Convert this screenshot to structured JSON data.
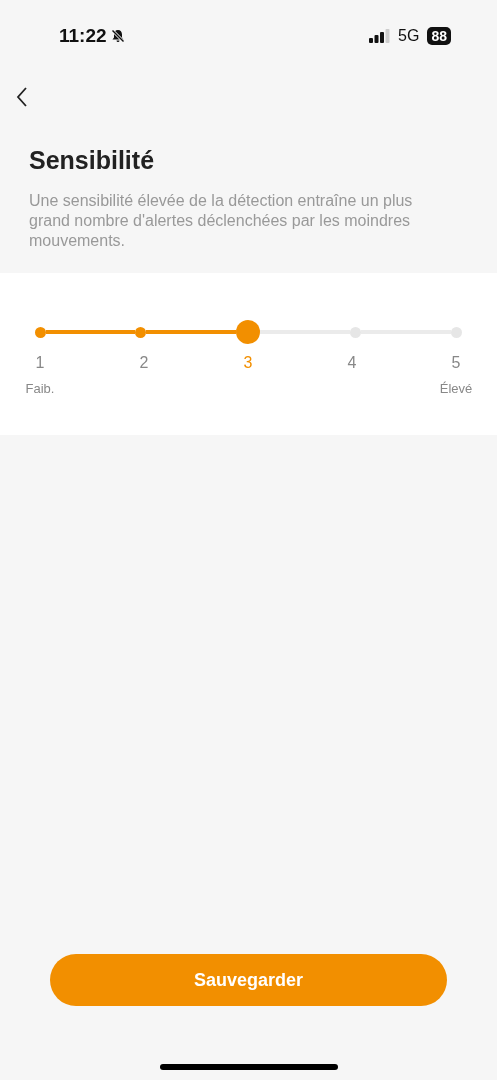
{
  "status_bar": {
    "time": "11:22",
    "network": "5G",
    "battery": "88"
  },
  "title": "Sensibilité",
  "description": "Une sensibilité élevée de la détection entraîne un plus grand nombre d'alertes déclenchées par les moindres mouvements.",
  "slider": {
    "steps": [
      {
        "label": "1",
        "caption": "Faib.",
        "selected": false
      },
      {
        "label": "2",
        "selected": false
      },
      {
        "label": "3",
        "selected": true
      },
      {
        "label": "4",
        "selected": false
      },
      {
        "label": "5",
        "caption": "Élevé",
        "selected": false
      }
    ]
  },
  "save_button": "Sauvegarder"
}
